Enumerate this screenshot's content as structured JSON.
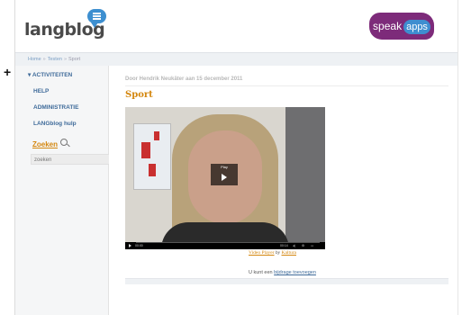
{
  "header": {
    "logo_text": "langblog",
    "partner_logo": {
      "speak": "speak",
      "apps": "apps"
    },
    "brand_colors": {
      "purple": "#7d2b7a",
      "blue": "#3d8fd0",
      "orange": "#d4870f"
    }
  },
  "breadcrumb": {
    "items": [
      "Home",
      "Testen",
      "Sport"
    ],
    "separator": "»"
  },
  "sidebar": {
    "section_label": "ACTIVITEITEN",
    "items": [
      {
        "label": "HELP"
      },
      {
        "label": "ADMINISTRATIE"
      },
      {
        "label": "LANGblog hulp"
      }
    ],
    "search": {
      "title": "Zoeken",
      "icon": "search-icon",
      "value": "zoeken"
    }
  },
  "post": {
    "meta": "Door Hendrik Neukäter aan 15 december 2011",
    "title": "Sport",
    "video": {
      "play_label": "Play",
      "time_elapsed": "00:00",
      "time_total": "00:14"
    },
    "player_caption": {
      "prefix": "Video Player",
      "by": "by",
      "vendor": "Kaltura"
    },
    "contribute": {
      "text": "U kunt een",
      "link": "bijdrage toevoegen"
    }
  }
}
